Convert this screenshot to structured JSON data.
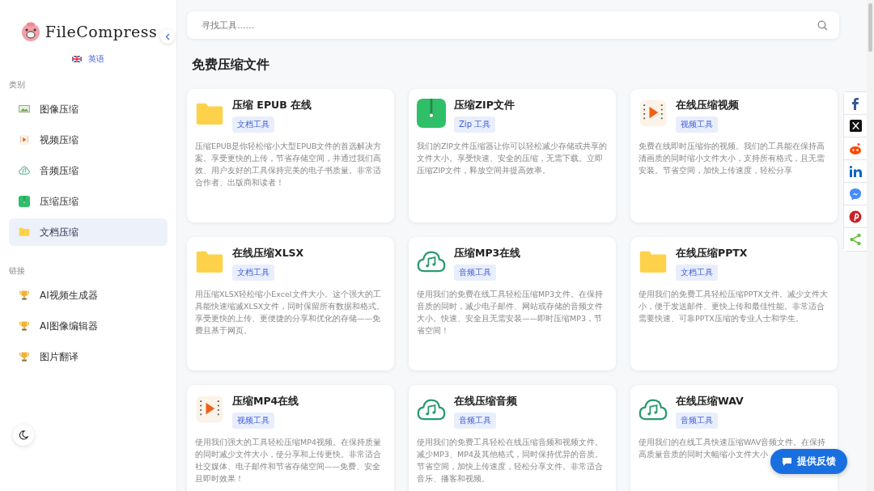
{
  "sidebar": {
    "logo_text": "FileCompress",
    "language": "英语",
    "sections": [
      {
        "title": "类别",
        "items": [
          {
            "label": "图像压缩",
            "kind": "image",
            "selected": false
          },
          {
            "label": "视频压缩",
            "kind": "video",
            "selected": false
          },
          {
            "label": "音频压缩",
            "kind": "audio",
            "selected": false
          },
          {
            "label": "压缩压缩",
            "kind": "zip",
            "selected": false
          },
          {
            "label": "文档压缩",
            "kind": "folder",
            "selected": true
          }
        ]
      },
      {
        "title": "链接",
        "items": [
          {
            "label": "AI视频生成器",
            "kind": "trophy",
            "selected": false
          },
          {
            "label": "AI图像编辑器",
            "kind": "trophy",
            "selected": false
          },
          {
            "label": "图片翻译",
            "kind": "trophy",
            "selected": false
          }
        ]
      }
    ]
  },
  "search": {
    "placeholder": "寻找工具......"
  },
  "heading": "免费压缩文件",
  "cards": [
    {
      "title": "压缩 EPUB 在线",
      "tag": "文档工具",
      "kind": "folder",
      "description": "压缩EPUB是你轻松缩小大型EPUB文件的首选解决方案。享受更快的上传，节省存储空间，并通过我们高效、用户友好的工具保持完美的电子书质量。非常适合作者、出版商和读者！"
    },
    {
      "title": "压缩ZIP文件",
      "tag": "Zip 工具",
      "kind": "zip",
      "description": "我们的ZIP文件压缩器让你可以轻松减少存储或共享的文件大小。享受快速、安全的压缩，无需下载。立即压缩ZIP文件，释放空间并提高效率。"
    },
    {
      "title": "在线压缩视频",
      "tag": "视频工具",
      "kind": "video",
      "description": "免费在线即时压缩你的视频。我们的工具能在保持高清画质的同时缩小文件大小，支持所有格式，且无需安装。节省空间，加快上传速度，轻松分享"
    },
    {
      "title": "在线压缩XLSX",
      "tag": "文档工具",
      "kind": "folder",
      "description": "用压缩XLSX轻松缩小Excel文件大小。这个强大的工具能快速缩减XLSX文件，同时保留所有数据和格式。享受更快的上传、更便捷的分享和优化的存储——免费且基于网页。"
    },
    {
      "title": "压缩MP3在线",
      "tag": "音频工具",
      "kind": "audio",
      "description": "使用我们的免费在线工具轻松压缩MP3文件。在保持音质的同时，减少电子邮件、网站或存储的音频文件大小。快速、安全且无需安装——即时压缩MP3，节省空间！"
    },
    {
      "title": "在线压缩PPTX",
      "tag": "文档工具",
      "kind": "folder",
      "description": "使用我们的免费工具轻松压缩PPTX文件。减少文件大小，便于发送邮件、更快上传和最佳性能。非常适合需要快速、可靠PPTX压缩的专业人士和学生。"
    },
    {
      "title": "压缩MP4在线",
      "tag": "视频工具",
      "kind": "video",
      "description": "使用我们强大的工具轻松压缩MP4视频。在保持质量的同时减少文件大小，使分享和上传更快。非常适合社交媒体、电子邮件和节省存储空间——免费、安全且即时效果！"
    },
    {
      "title": "在线压缩音频",
      "tag": "音频工具",
      "kind": "audio",
      "description": "使用我们的免费工具轻松在线压缩音频和视频文件。减少MP3、MP4及其他格式，同时保持优异的音质。节省空间，加快上传速度，轻松分享文件。非常适合音乐、播客和视频。"
    },
    {
      "title": "在线压缩WAV",
      "tag": "音频工具",
      "kind": "audio",
      "description": "使用我们的在线工具快速压缩WAV音频文件。在保持高质量音质的同时大幅缩小文件大小，"
    }
  ],
  "share": [
    {
      "kind": "facebook"
    },
    {
      "kind": "x"
    },
    {
      "kind": "reddit"
    },
    {
      "kind": "linkedin"
    },
    {
      "kind": "messenger"
    },
    {
      "kind": "pinterest"
    },
    {
      "kind": "share"
    }
  ],
  "feedback_button": "提供反馈"
}
